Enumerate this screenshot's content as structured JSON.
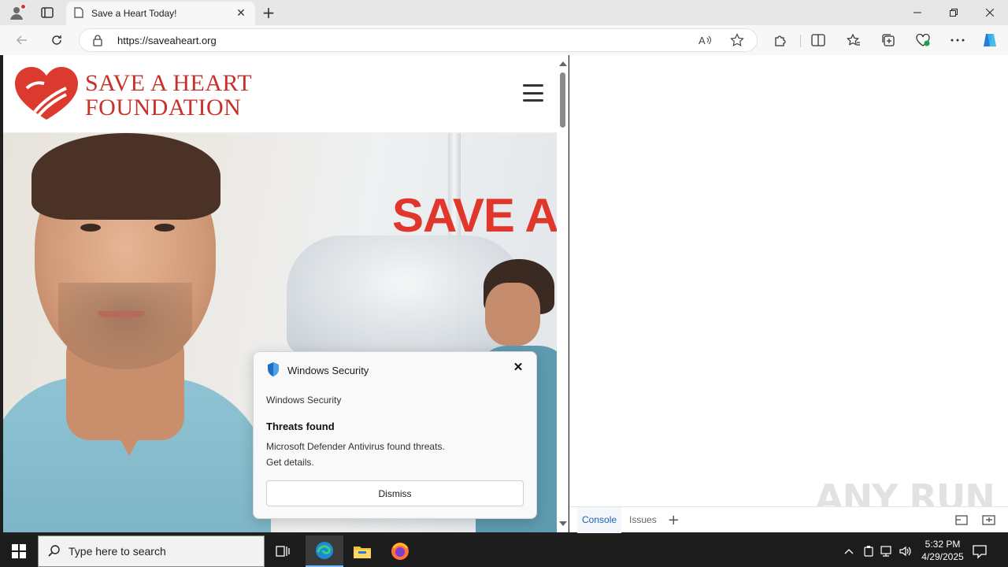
{
  "browser": {
    "tab_title": "Save a Heart Today!",
    "url": "https://saveaheart.org",
    "new_tab_symbol": "+",
    "close_tab_symbol": "✕"
  },
  "site": {
    "logo_line1": "SAVE A HEART",
    "logo_line2": "FOUNDATION",
    "hero_headline": "SAVE A",
    "brand_color": "#c8302a",
    "headline_color": "#e0362b"
  },
  "toast": {
    "app_name": "Windows Security",
    "attribution": "Windows Security",
    "title": "Threats found",
    "body_line1": "Microsoft Defender Antivirus found threats.",
    "body_line2": "Get details.",
    "dismiss_label": "Dismiss",
    "close_symbol": "✕"
  },
  "devtools": {
    "tabs": [
      "Console",
      "Issues"
    ],
    "active_tab": "Console",
    "add_symbol": "+",
    "watermark": "ANY RUN"
  },
  "taskbar": {
    "search_placeholder": "Type here to search",
    "time": "5:32 PM",
    "date": "4/29/2025"
  },
  "icons": {
    "profile": "profile-icon",
    "tab_actions": "tab-actions-icon",
    "page": "page-icon",
    "back": "back-arrow-icon",
    "refresh": "refresh-icon",
    "lock": "lock-icon",
    "read_aloud": "read-aloud-icon",
    "favorite": "star-icon",
    "extensions": "puzzle-icon",
    "split_screen": "split-screen-icon",
    "favorites": "favorites-icon",
    "collections": "collections-icon",
    "performance": "heartbeat-icon",
    "more": "ellipsis-icon",
    "copilot": "copilot-icon",
    "shield": "shield-icon"
  }
}
